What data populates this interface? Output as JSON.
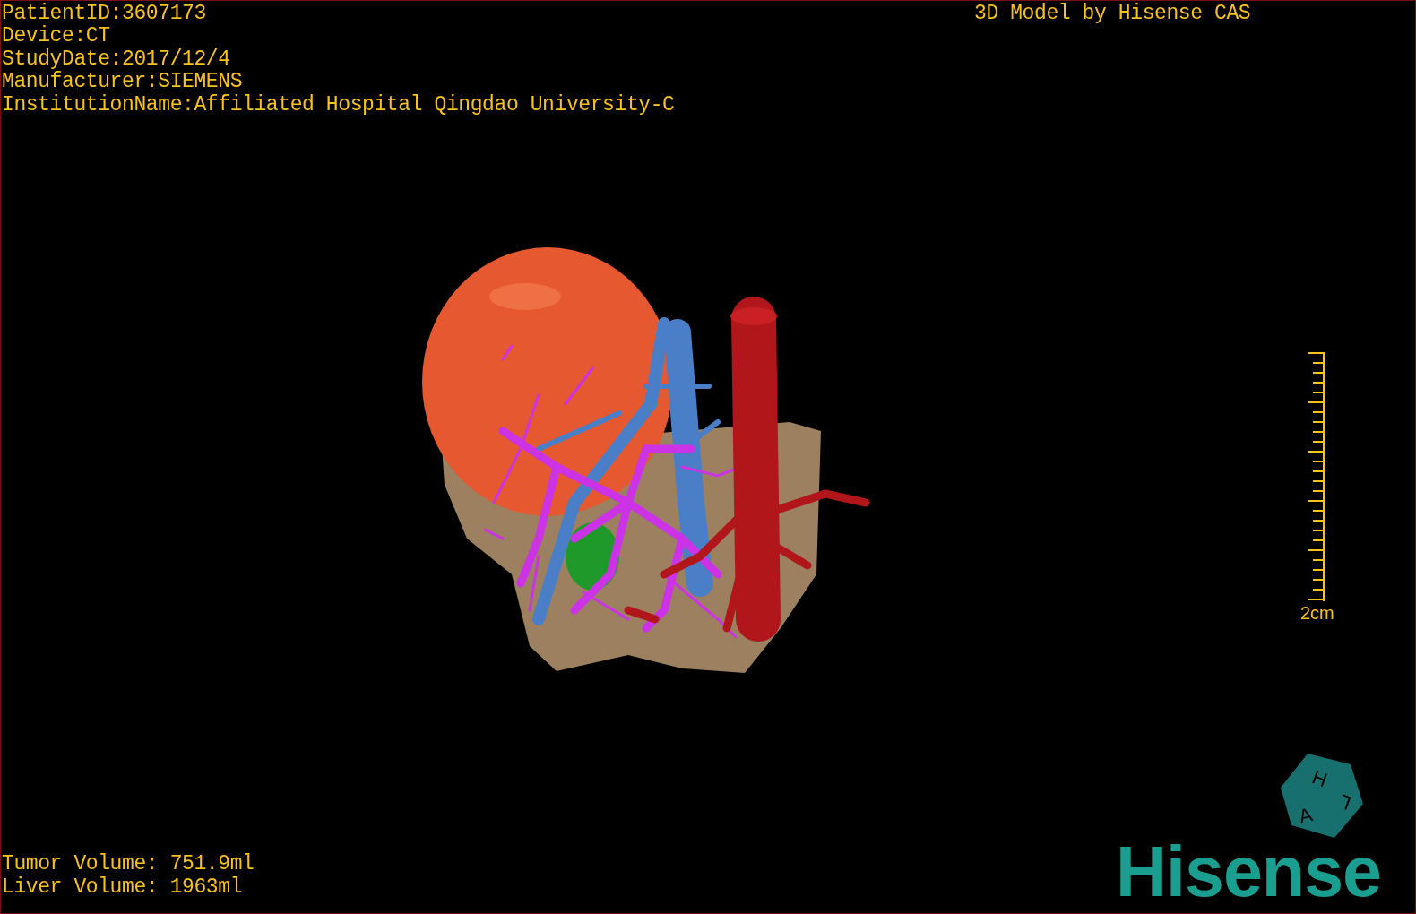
{
  "patient_info": [
    "PatientID:3607173",
    "Device:CT",
    "StudyDate:2017/12/4",
    "Manufacturer:SIEMENS",
    "InstitutionName:Affiliated Hospital Qingdao University-C"
  ],
  "title": "3D Model by Hisense CAS",
  "scale_bar": {
    "label": "2cm"
  },
  "orientation_cube": {
    "labels": [
      "H",
      "A",
      "L"
    ]
  },
  "volumes": [
    "Tumor Volume: 751.9ml",
    "Liver Volume: 1963ml"
  ],
  "logo": "Hisense"
}
